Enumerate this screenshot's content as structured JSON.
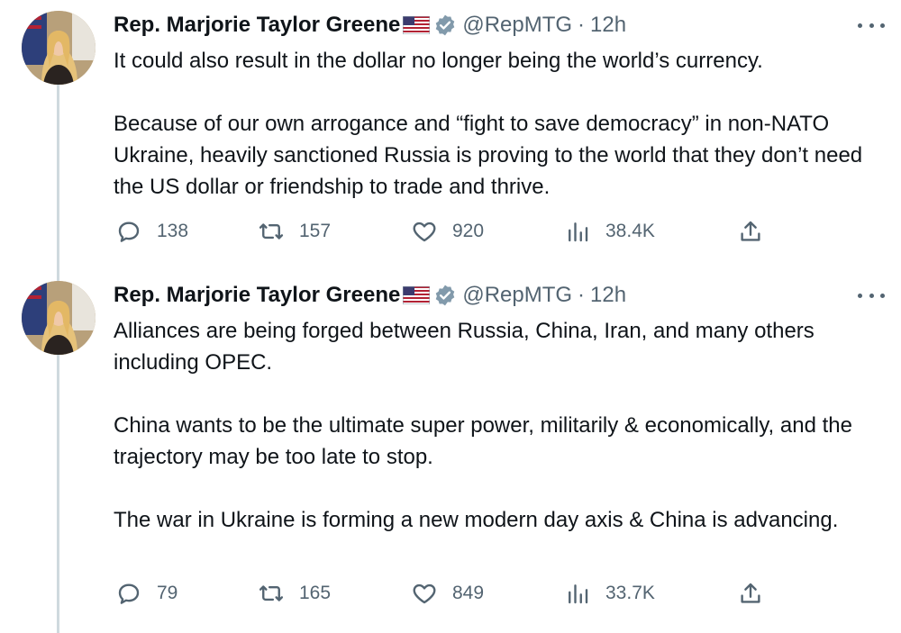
{
  "tweets": [
    {
      "author_name": "Rep. Marjorie Taylor Greene",
      "handle": "@RepMTG",
      "separator": "·",
      "time": "12h",
      "paragraphs": [
        "It could also result in the dollar no longer being the world’s currency.",
        "Because of our own arrogance and “fight to save democracy” in non-NATO Ukraine, heavily sanctioned Russia is proving to the world that they don’t need the US dollar or friendship to trade and thrive."
      ],
      "replies": "138",
      "retweets": "157",
      "likes": "920",
      "views": "38.4K"
    },
    {
      "author_name": "Rep. Marjorie Taylor Greene",
      "handle": "@RepMTG",
      "separator": "·",
      "time": "12h",
      "paragraphs": [
        "Alliances are being forged between Russia, China, Iran, and many others including OPEC.",
        "China wants to be the ultimate super power, militarily & economically, and the trajectory may be too late to stop.",
        "The war in Ukraine is forming a new modern day axis & China is advancing."
      ],
      "replies": "79",
      "retweets": "165",
      "likes": "849",
      "views": "33.7K"
    }
  ],
  "icons": {
    "flag": "us-flag-icon",
    "verified": "verified-badge-icon",
    "more": "more-options-icon",
    "reply": "reply-icon",
    "retweet": "retweet-icon",
    "like": "heart-icon",
    "views": "views-chart-icon",
    "share": "share-icon"
  },
  "colors": {
    "text": "#0f1419",
    "secondary": "#536471",
    "thread_line": "#cfd9de",
    "verified_badge": "#829aab"
  }
}
